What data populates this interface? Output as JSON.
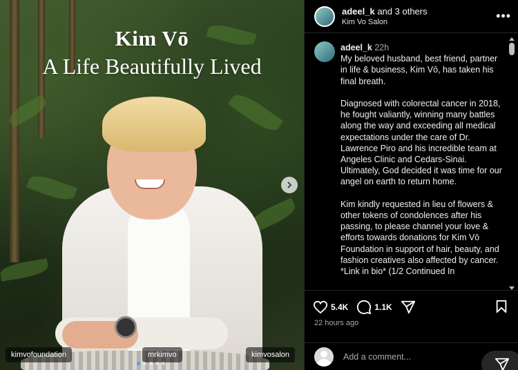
{
  "photo": {
    "headline_name": "Kim Vō",
    "headline_sub": "A Life Beautifully Lived",
    "tags": [
      "kimvofoundation",
      "mrkimvo",
      "kimvosalon"
    ],
    "carousel_total": 5,
    "carousel_active": 1
  },
  "post_header": {
    "username": "adeel_k",
    "and_others": "and 3 others",
    "location": "Kim Vo Salon"
  },
  "caption": {
    "username": "adeel_k",
    "time": "22h",
    "text": "My beloved husband, best friend, partner in life & business, Kim Vō, has taken his final breath.\n\nDiagnosed with colorectal cancer in 2018, he fought valiantly, winning many battles along the way and exceeding all medical expectations under the care of Dr. Lawrence Piro and his incredible team at Angeles Clinic and Cedars-Sinai. Ultimately, God decided it was time for our angel on earth to return home.\n\nKim kindly requested in lieu of flowers & other tokens of condolences after his passing, to please channel your love & efforts towards donations for Kim Vō Foundation in support of hair, beauty, and fashion creatives also affected by cancer. *Link in bio* (1/2 Continued In"
  },
  "actions": {
    "likes": "5.4K",
    "comments": "1.1K",
    "time_ago": "22 hours ago"
  },
  "comment_box": {
    "placeholder": "Add a comment..."
  },
  "colors": {
    "panel_bg": "#000000",
    "divider": "#262626",
    "muted_text": "#a8a8a8",
    "carousel_active": "#4aa3ff"
  },
  "icons": [
    "more-options-icon",
    "heart-icon",
    "comment-icon",
    "share-icon",
    "bookmark-icon",
    "chevron-right-icon",
    "send-icon"
  ]
}
